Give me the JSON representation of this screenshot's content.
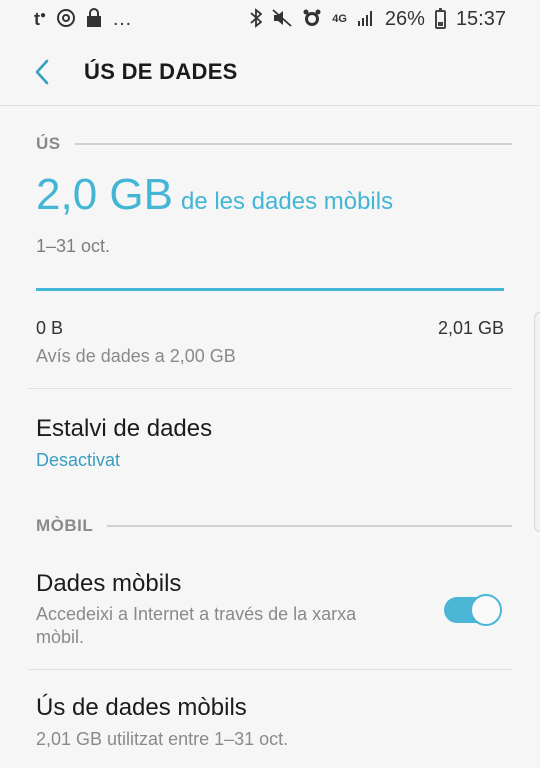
{
  "status_bar": {
    "left_glyphs": [
      "t",
      "@",
      "lock",
      "..."
    ],
    "network": "4G",
    "battery_percent": "26%",
    "time": "15:37",
    "icons": [
      "bluetooth-icon",
      "mute-icon",
      "alarm-icon",
      "network-4g-icon",
      "signal-icon",
      "battery-icon"
    ]
  },
  "app_bar": {
    "title": "ÚS DE DADES",
    "back_icon": "chevron-left-icon"
  },
  "usage_section": {
    "header": "ÚS",
    "amount": "2,0 GB",
    "amount_suffix": "de les dades mòbils",
    "period": "1–31 oct.",
    "bar_fraction": 1.0,
    "bar_min": "0 B",
    "bar_max": "2,01 GB",
    "warning": "Avís de dades a 2,00 GB"
  },
  "data_saver": {
    "title": "Estalvi de dades",
    "status": "Desactivat"
  },
  "mobile_section": {
    "header": "MÒBIL",
    "mobile_data": {
      "title": "Dades mòbils",
      "subtitle_line1": "Accedeixi a Internet a través de la xarxa",
      "subtitle_line2": "mòbil.",
      "enabled": true
    },
    "mobile_usage": {
      "title": "Ús de dades mòbils",
      "subtitle": "2,01 GB utilitzat entre 1–31 oct."
    }
  },
  "colors": {
    "accent": "#43b6d6",
    "background": "#f6f6f6"
  }
}
